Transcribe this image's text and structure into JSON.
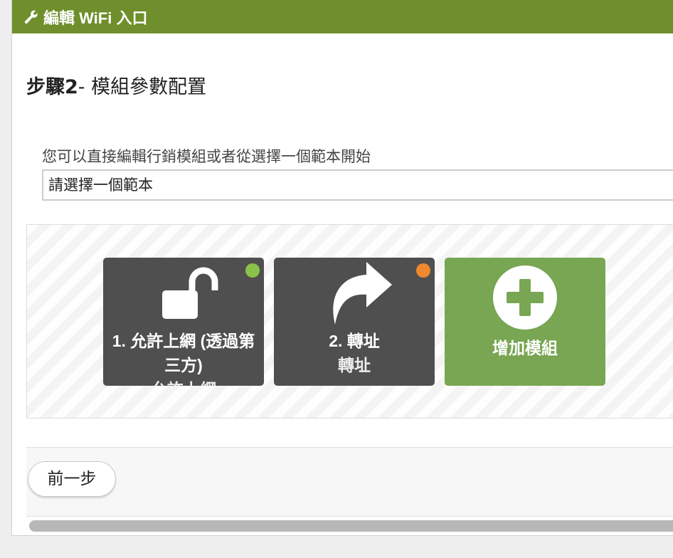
{
  "header": {
    "title": "編輯 WiFi 入口",
    "icon": "wrench-icon",
    "color": "#6e8f2b"
  },
  "step": {
    "number": "步驟2",
    "title": "- 模組參數配置"
  },
  "template": {
    "label": "您可以直接編輯行銷模組或者從選擇一個範本開始",
    "selected": "請選擇一個範本"
  },
  "modules": [
    {
      "label": "1. 允許上網 (透過第三方)",
      "sublabel": "允許上網",
      "icon": "unlock-icon",
      "status_color": "#8bc34a",
      "bg": "#4f4f4f"
    },
    {
      "label": "2. 轉址",
      "sublabel": "轉址",
      "icon": "share-arrow-icon",
      "status_color": "#f0892e",
      "bg": "#4f4f4f"
    }
  ],
  "add_module": {
    "label": "增加模組",
    "icon": "plus-circle-icon",
    "bg": "#78a653"
  },
  "footer": {
    "prev_label": "前一步"
  }
}
